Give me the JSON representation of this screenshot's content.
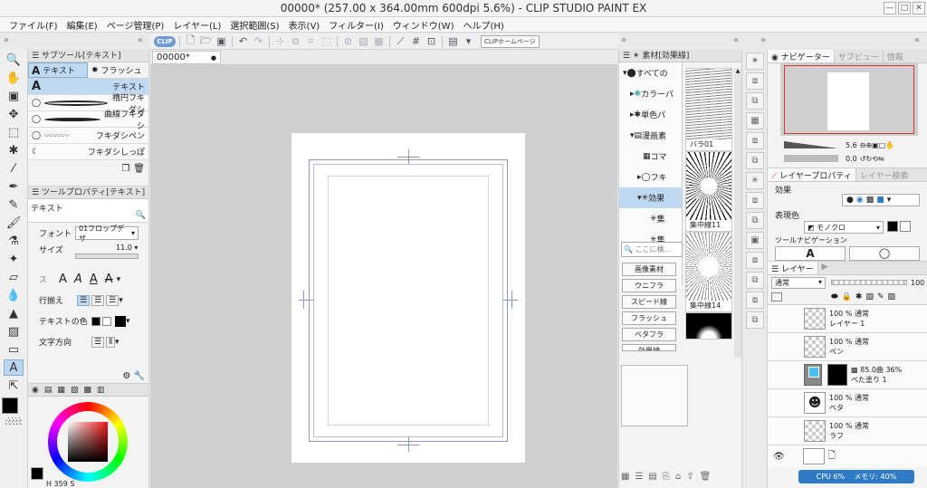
{
  "window": {
    "title": "00000* (257.00 x 364.00mm 600dpi 5.6%)  - CLIP STUDIO PAINT EX",
    "minimize": "—",
    "maximize": "□",
    "close": "✕"
  },
  "menu": [
    "ファイル(F)",
    "編集(E)",
    "ページ管理(P)",
    "レイヤー(L)",
    "選択範囲(S)",
    "表示(V)",
    "フィルター(I)",
    "ウィンドウ(W)",
    "ヘルプ(H)"
  ],
  "command_bar": {
    "clip_label": "CLIP",
    "home_label": "CLIPホームページ"
  },
  "subtool": {
    "header": "サブツール[テキスト]",
    "tabs": [
      "テキスト",
      "フラッシュ"
    ],
    "items": [
      "テキスト",
      "楕円フキダシ",
      "曲線フキダシ",
      "フキダシペン",
      "フキダシしっぽ"
    ]
  },
  "tool_property": {
    "header": "ツールプロパティ[テキスト]",
    "name": "テキスト",
    "font_label": "フォント",
    "font_value": "01フロップデザ",
    "size_label": "サイズ",
    "size_value": "11.0",
    "style_label": "ス",
    "align_label": "行揃え",
    "color_label": "テキストの色",
    "direction_label": "文字方向"
  },
  "color_panel": {
    "accent": "#2f7ac7",
    "values": "H 359 S"
  },
  "document": {
    "tab": "00000*",
    "tab_dot": "●"
  },
  "material": {
    "header": "素材[効果線]",
    "tree": [
      "すべての",
      "カラーパ",
      "単色パ",
      "漫画素",
      "コマ",
      "フキ",
      "効果",
      "集",
      "集"
    ],
    "search_placeholder": "ここに検...",
    "categories": [
      "画像素材",
      "ウニフラ",
      "スピード線",
      "フラッシュ",
      "ベタフラ",
      "効果線"
    ],
    "thumbs": [
      "バラ01",
      "集中線11",
      "集中線14"
    ]
  },
  "navigator": {
    "tabs": [
      "ナビゲーター",
      "サブビュー",
      "情報"
    ],
    "zoom": "5.6",
    "rotate": "0.0"
  },
  "layer_property": {
    "tabs": [
      "レイヤープロパティ",
      "レイヤー検索"
    ],
    "effect_label": "効果",
    "expression_label": "表現色",
    "expression_value": "モノクロ",
    "tool_nav_label": "ツールナビゲーション",
    "tool_nav_glyph": "A"
  },
  "layers": {
    "tab": "レイヤー",
    "blend": "通常",
    "opacity": "100",
    "rows": [
      {
        "meta": "100 % 通常",
        "name": "レイヤー 1"
      },
      {
        "meta": "100 % 通常",
        "name": "ペン"
      },
      {
        "meta": "85.0曲 36%",
        "name": "べた塗り 1"
      },
      {
        "meta": "100 % 通常",
        "name": "ベタ"
      },
      {
        "meta": "100 % 通常",
        "name": "ラフ"
      }
    ]
  },
  "status": {
    "cpu": "CPU 6%",
    "memory": "メモリ: 40%"
  }
}
